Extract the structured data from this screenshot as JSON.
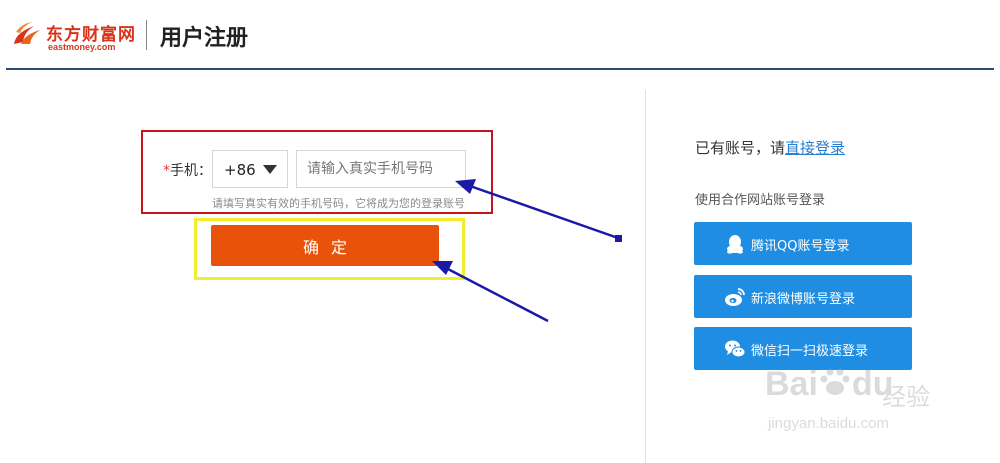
{
  "header": {
    "logo_cn": "东方财富网",
    "logo_en": "eastmoney.com",
    "title": "用户注册"
  },
  "form": {
    "phone_label_star": "*",
    "phone_label": "手机：",
    "country_code": "+86",
    "phone_placeholder": "请输入真实手机号码",
    "phone_value": "",
    "hint": "请填写真实有效的手机号码，它将成为您的登录账号",
    "confirm_label": "确定"
  },
  "side": {
    "has_account_prefix": "已有账号，请",
    "login_link": "直接登录",
    "partner_text": "使用合作网站账号登录",
    "buttons": [
      {
        "label": "腾讯QQ账号登录",
        "icon": "qq-icon"
      },
      {
        "label": "新浪微博账号登录",
        "icon": "weibo-icon"
      },
      {
        "label": "微信扫一扫极速登录",
        "icon": "wechat-icon"
      }
    ]
  },
  "watermark": {
    "brand": "Bai",
    "brand2": "du",
    "cn": "经验",
    "url": "jingyan.baidu.com"
  },
  "colors": {
    "brand_red": "#d9341b",
    "confirm_orange": "#e9520b",
    "social_blue": "#1f8ee2",
    "link_blue": "#2a7fd1",
    "highlight_red": "#c4161c",
    "highlight_yellow": "#f2ee2e",
    "arrow_blue": "#1a1aa6"
  }
}
